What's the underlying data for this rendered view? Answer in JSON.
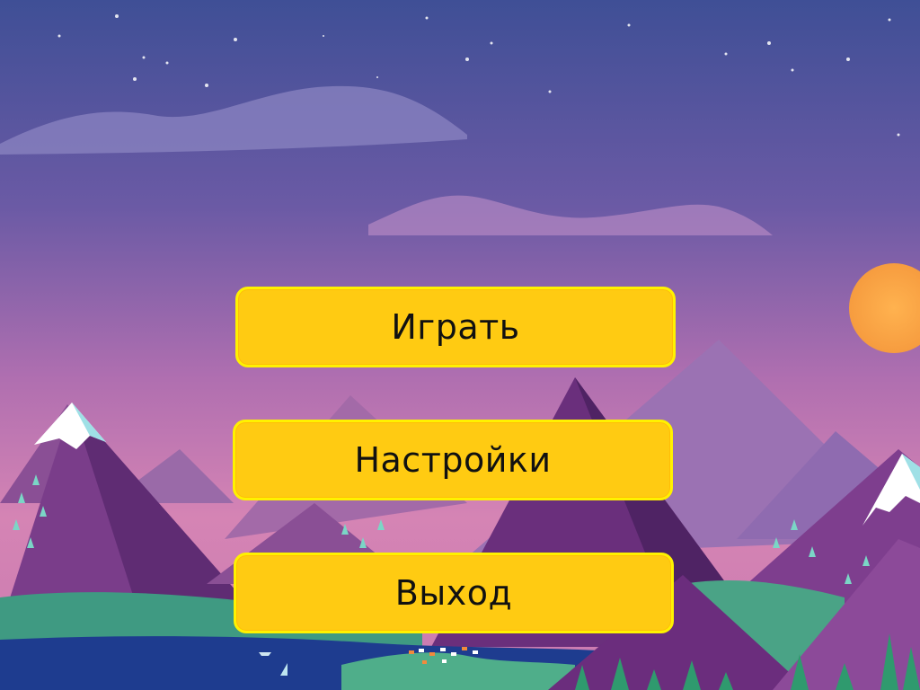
{
  "menu": {
    "play_label": "Играть",
    "settings_label": "Настройки",
    "exit_label": "Выход"
  },
  "colors": {
    "button_fill": "#ffcb12",
    "button_border": "#fff200",
    "sky_top": "#3f4f96",
    "sky_bottom": "#d07ab0",
    "sun": "#fbab47"
  }
}
